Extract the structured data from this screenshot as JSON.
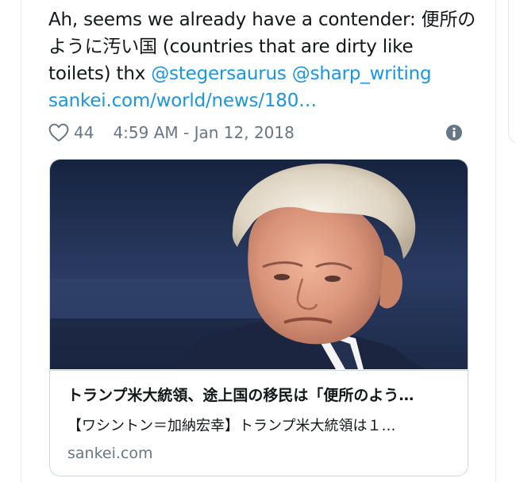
{
  "tweet": {
    "text_lines": [
      "Ah, seems we already have a contender: 便所の",
      "ように汚い国 (countries that are dirty like"
    ],
    "line3_text": "toilets) thx ",
    "mention1": "@stegersaurus",
    "mention2": "@sharp_writing",
    "link": "sankei.com/world/news/180…"
  },
  "meta": {
    "likes": "44",
    "timestamp": "4:59 AM - Jan 12, 2018"
  },
  "card": {
    "title": "トランプ米大統領、途上国の移民は「便所のよう…",
    "description": "【ワシントン＝加納宏幸】トランプ米大統領は１…",
    "domain": "sankei.com"
  },
  "icons": {
    "like": "heart-outline-icon",
    "info": "info-circle-icon"
  },
  "colors": {
    "link": "#1b95e0",
    "muted": "#657786",
    "border": "#ccd6dd"
  }
}
